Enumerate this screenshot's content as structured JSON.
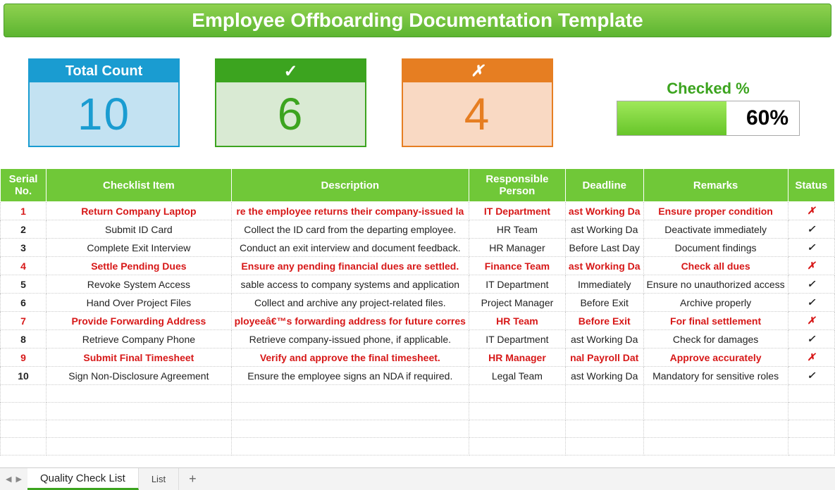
{
  "title": "Employee Offboarding Documentation Template",
  "summary": {
    "total_label": "Total Count",
    "total_value": "10",
    "check_symbol": "✓",
    "check_value": "6",
    "cross_symbol": "✗",
    "cross_value": "4",
    "checked_label": "Checked %",
    "checked_percent": "60%",
    "checked_fill_pct": 60
  },
  "columns": {
    "serial": "Serial No.",
    "item": "Checklist Item",
    "description": "Description",
    "responsible": "Responsible Person",
    "deadline": "Deadline",
    "remarks": "Remarks",
    "status": "Status"
  },
  "rows": [
    {
      "serial": "1",
      "item": "Return Company Laptop",
      "description": "re the employee returns their company-issued la",
      "responsible": "IT Department",
      "deadline": "ast Working Da",
      "remarks": "Ensure proper condition",
      "status": "✗",
      "checked": false
    },
    {
      "serial": "2",
      "item": "Submit ID Card",
      "description": "Collect the ID card from the departing employee.",
      "responsible": "HR Team",
      "deadline": "ast Working Da",
      "remarks": "Deactivate immediately",
      "status": "✓",
      "checked": true
    },
    {
      "serial": "3",
      "item": "Complete Exit Interview",
      "description": "Conduct an exit interview and document feedback.",
      "responsible": "HR Manager",
      "deadline": "Before Last Day",
      "remarks": "Document findings",
      "status": "✓",
      "checked": true
    },
    {
      "serial": "4",
      "item": "Settle Pending Dues",
      "description": "Ensure any pending financial dues are settled.",
      "responsible": "Finance Team",
      "deadline": "ast Working Da",
      "remarks": "Check all dues",
      "status": "✗",
      "checked": false
    },
    {
      "serial": "5",
      "item": "Revoke System Access",
      "description": "sable access to company systems and application",
      "responsible": "IT Department",
      "deadline": "Immediately",
      "remarks": "Ensure no unauthorized access",
      "status": "✓",
      "checked": true
    },
    {
      "serial": "6",
      "item": "Hand Over Project Files",
      "description": "Collect and archive any project-related files.",
      "responsible": "Project Manager",
      "deadline": "Before Exit",
      "remarks": "Archive properly",
      "status": "✓",
      "checked": true
    },
    {
      "serial": "7",
      "item": "Provide Forwarding Address",
      "description": "ployeeâ€™s forwarding address for future corres",
      "responsible": "HR Team",
      "deadline": "Before Exit",
      "remarks": "For final settlement",
      "status": "✗",
      "checked": false
    },
    {
      "serial": "8",
      "item": "Retrieve Company Phone",
      "description": "Retrieve company-issued phone, if applicable.",
      "responsible": "IT Department",
      "deadline": "ast Working Da",
      "remarks": "Check for damages",
      "status": "✓",
      "checked": true
    },
    {
      "serial": "9",
      "item": "Submit Final Timesheet",
      "description": "Verify and approve the final timesheet.",
      "responsible": "HR Manager",
      "deadline": "nal Payroll Dat",
      "remarks": "Approve accurately",
      "status": "✗",
      "checked": false
    },
    {
      "serial": "10",
      "item": "Sign Non-Disclosure Agreement",
      "description": "Ensure the employee signs an NDA if required.",
      "responsible": "Legal Team",
      "deadline": "ast Working Da",
      "remarks": "Mandatory for sensitive roles",
      "status": "✓",
      "checked": true
    }
  ],
  "tabs": {
    "active": "Quality Check List",
    "other": "List",
    "add": "+"
  }
}
